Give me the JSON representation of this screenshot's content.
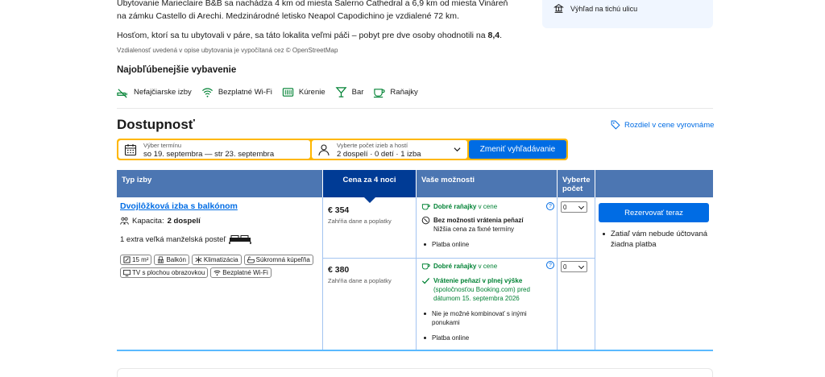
{
  "intro": {
    "para1": "Ubytovanie Marieclaire B&B sa nachádza 4 km od miesta Salerno Cathedral a 6,9 km od miesta Vináreň na zámku Castello di Arechi. Medzinárodné letisko Neapol Capodichino je vzdialené 72 km.",
    "para2_prefix": "Hosťom, ktorí sa tu ubytovali v páre, sa táto lokalita veľmi páči – pobyt pre dve osoby ohodnotili na ",
    "para2_score": "8,4",
    "para2_suffix": ".",
    "distance_note": "Vzdialenosť uvedená v opise ubytovania je vypočítaná cez © OpenStreetMap"
  },
  "side_box": {
    "item": "Výhľad na tichú ulicu",
    "icon": "landmark-icon"
  },
  "facilities": {
    "title": "Najobľúbenejšie vybavenie",
    "items": [
      {
        "label": "Nefajčiarske izby",
        "icon": "no-smoking-icon"
      },
      {
        "label": "Bezplatné Wi-Fi",
        "icon": "wifi-icon"
      },
      {
        "label": "Kúrenie",
        "icon": "heater-icon"
      },
      {
        "label": "Bar",
        "icon": "cocktail-icon"
      },
      {
        "label": "Raňajky",
        "icon": "coffee-cup-icon"
      }
    ]
  },
  "availability": {
    "title": "Dostupnosť",
    "price_match_link": "Rozdiel v cene vyrovnáme"
  },
  "search": {
    "date_label": "Výber termínu",
    "date_value": "so 19. septembra  —  str 23. septembra",
    "guests_label": "Vyberte počet izieb a hostí",
    "guests_value": "2 dospelí · 0 detí · 1 izba",
    "button": "Zmeniť vyhľadávanie"
  },
  "table": {
    "headers": {
      "room_type": "Typ izby",
      "price": "Cena za 4 noci",
      "options": "Vaše možnosti",
      "select": "Vyberte počet"
    },
    "room": {
      "name": "Dvojlôžková izba s balkónom",
      "capacity_label": "Kapacita:",
      "capacity_value": "2 dospelí",
      "bed": "1 extra veľká manželská posteľ",
      "amenities": [
        {
          "label": "15 m²",
          "icon": "room-size-icon"
        },
        {
          "label": "Balkón",
          "icon": "balcony-icon"
        },
        {
          "label": "Klimatizácia",
          "icon": "snowflake-icon"
        },
        {
          "label": "Súkromná kúpeľňa",
          "icon": "bathtub-icon"
        },
        {
          "label": "TV s plochou obrazovkou",
          "icon": "tv-icon"
        },
        {
          "label": "Bezplatné Wi-Fi",
          "icon": "wifi-icon"
        }
      ]
    },
    "rates": [
      {
        "price": "€ 354",
        "taxes": "Zahŕňa dane a poplatky",
        "breakfast": "Dobré raňajky",
        "breakfast_suffix": " v cene",
        "refund_title": "Bez možnosti vrátenia peňazí",
        "refund_detail": "Nižšia cena za fixné termíny",
        "payment": "Platba online",
        "selected_qty": "0"
      },
      {
        "price": "€ 380",
        "taxes": "Zahŕňa dane a poplatky",
        "breakfast": "Dobré raňajky",
        "breakfast_suffix": " v cene",
        "refund_title": "Vrátenie peňazí v plnej výške",
        "refund_detail": "(spoločnosťou Booking.com) pred dátumom 15. septembra 2026",
        "combo": "Nie je možné kombinovať s inými ponukami",
        "payment": "Platba online",
        "selected_qty": "0"
      }
    ],
    "reserve_button": "Rezervovať teraz",
    "reserve_note": "Zatiaľ vám nebude účtovaná žiadna platba"
  },
  "colors": {
    "brand_blue": "#006ce4",
    "header_blue": "#4c76b2",
    "dark_blue": "#003b95",
    "search_yellow": "#ffb700",
    "green": "#008234"
  }
}
